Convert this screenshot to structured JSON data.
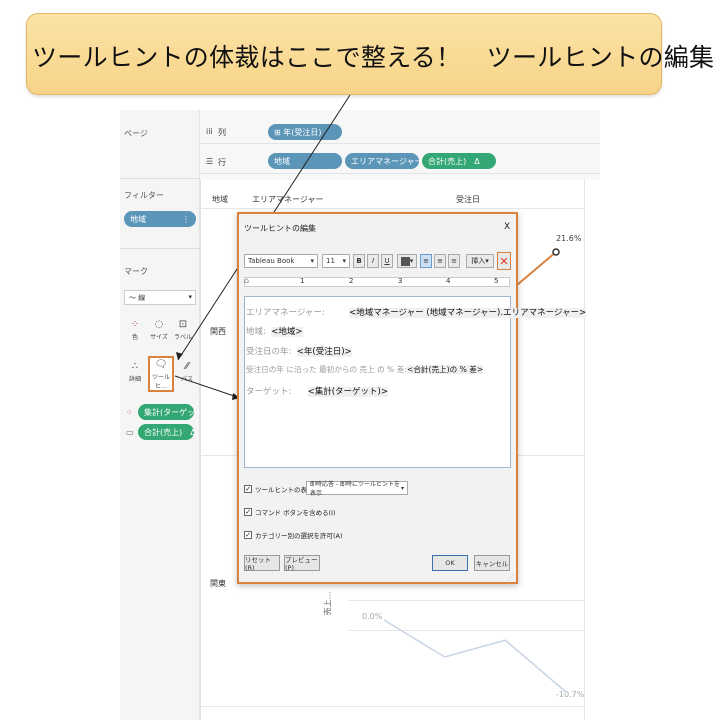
{
  "banner": {
    "text": "ツールヒントの体裁はここで整える！　ツールヒントの編集"
  },
  "sidebar": {
    "pages_label": "ページ",
    "filters_label": "フィルター",
    "filter_pill": "地域",
    "marks_label": "マーク",
    "mark_type": "線",
    "buttons": [
      {
        "label": "色",
        "icon": "color-icon"
      },
      {
        "label": "サイズ",
        "icon": "size-icon"
      },
      {
        "label": "ラベル",
        "icon": "label-icon"
      },
      {
        "label": "詳細",
        "icon": "detail-icon"
      },
      {
        "label": "ツールヒ…",
        "icon": "tooltip-icon"
      },
      {
        "label": "パス",
        "icon": "path-icon"
      }
    ],
    "mark_pills": [
      "集計(ターゲット)",
      "合計(売上)　Δ"
    ]
  },
  "shelves": {
    "columns_label": "列",
    "columns_pill": "年(受注日)",
    "rows_label": "行",
    "rows_pills": [
      "地域",
      "エリアマネージャー",
      "合計(売上)　Δ"
    ]
  },
  "viz": {
    "headers": [
      "地域",
      "エリアマネージャー",
      "受注日"
    ],
    "region_a": "関西",
    "region_b": "関東",
    "axis_label": "売上…",
    "label_top": "21.6%",
    "label_zero": "0.0%",
    "label_bottom": "-10.7%",
    "line_series": [
      0.0,
      -5.5,
      -3.0,
      -10.7
    ]
  },
  "dialog": {
    "title": "ツールヒントの編集",
    "close": "X",
    "font_name": "Tableau Book",
    "font_size": "11",
    "insert_label": "挿入",
    "ruler_numbers": [
      "1",
      "2",
      "3",
      "4",
      "5"
    ],
    "lines": [
      {
        "label": "エリアマネージャー:",
        "field": "<地域マネージャー (地域マネージャー).エリアマネージャー>"
      },
      {
        "label": "地域:",
        "field": "<地域>"
      },
      {
        "label": "受注日の年:",
        "field": "<年(受注日)>"
      },
      {
        "label": "受注日の年 に沿った 最初からの 売上 の % 差:",
        "field": "<合計(売上)の % 差>"
      },
      {
        "label": "ターゲット:",
        "field": "<集計(ターゲット)>"
      }
    ],
    "show_tooltip_label": "ツールヒントの表示(S)",
    "show_tooltip_option": "即時応答 - 即時にツールヒントを表示",
    "include_command_label": "コマンド ボタンを含める(I)",
    "allow_category_label": "カテゴリー別の選択を許可(A)",
    "reset_button": "リセット(R)",
    "preview_button": "プレビュー(P)",
    "ok_button": "OK",
    "cancel_button": "キャンセル"
  },
  "colors": {
    "accent_orange": "#d9823f",
    "pill_blue": "#5b95b8",
    "pill_green": "#34a874",
    "banner_fill": "#f9d78f"
  }
}
